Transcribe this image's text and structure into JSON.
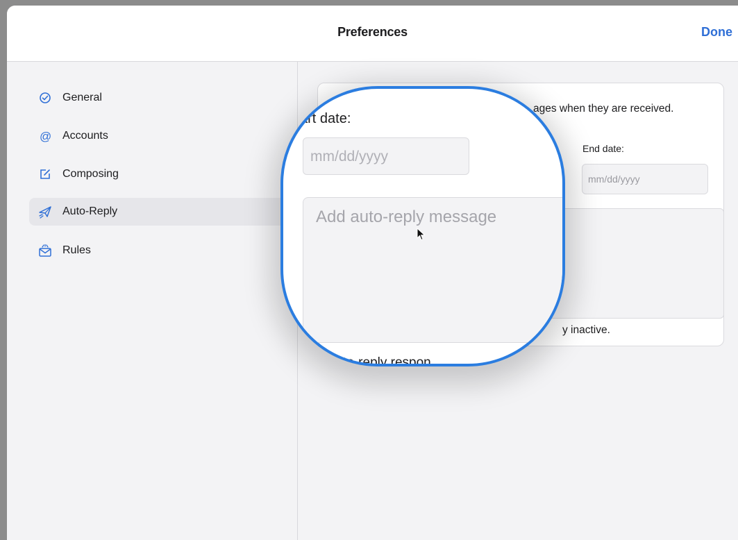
{
  "window": {
    "title": "Preferences",
    "done_label": "Done"
  },
  "sidebar": {
    "items": [
      {
        "label": "General",
        "icon": "checkmark-circle-icon",
        "selected": false
      },
      {
        "label": "Accounts",
        "icon": "at-sign-icon",
        "selected": false
      },
      {
        "label": "Composing",
        "icon": "compose-icon",
        "selected": false
      },
      {
        "label": "Auto-Reply",
        "icon": "paper-plane-icon",
        "selected": true
      },
      {
        "label": "Rules",
        "icon": "envelope-rules-icon",
        "selected": false
      }
    ]
  },
  "auto_reply": {
    "description_fragment": "ages when they are received.",
    "start_date_label_fragment": "art date:",
    "start_date_placeholder": "mm/dd/yyyy",
    "end_date_label": "End date:",
    "end_date_placeholder": "mm/dd/yyyy",
    "message_placeholder": "Add auto-reply message",
    "inactive_fragment": "y inactive.",
    "bottom_fragment": "to-reply respon"
  },
  "colors": {
    "accent": "#2f6fd6",
    "magnifier_ring": "#2b7de0"
  }
}
